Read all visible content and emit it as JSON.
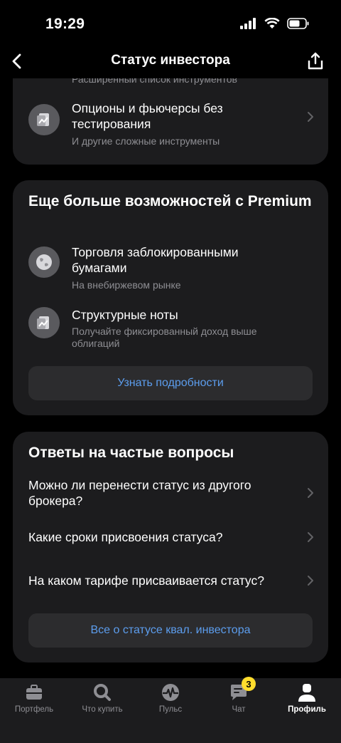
{
  "status_bar": {
    "time": "19:29"
  },
  "header": {
    "title": "Статус инвестора"
  },
  "card1": {
    "cut_subtitle": "Расширенный список инструментов",
    "item": {
      "title": "Опционы и фьючерсы без тестирования",
      "subtitle": "И другие сложные инструменты"
    }
  },
  "premium": {
    "title": "Еще больше возможностей с Premium",
    "items": [
      {
        "title": "Торговля заблокированными бумагами",
        "subtitle": "На внебиржевом рынке"
      },
      {
        "title": "Структурные ноты",
        "subtitle": "Получайте фиксированный доход выше облигаций"
      }
    ],
    "button": "Узнать подробности"
  },
  "faq": {
    "title": "Ответы на частые вопросы",
    "items": [
      "Можно ли перенести статус из другого брокера?",
      "Какие сроки присвоения статуса?",
      "На каком тарифе присваивается статус?"
    ],
    "button": "Все о статусе квал. инвестора"
  },
  "tabs": [
    {
      "label": "Портфель",
      "icon": "briefcase-icon"
    },
    {
      "label": "Что купить",
      "icon": "search-icon"
    },
    {
      "label": "Пульс",
      "icon": "pulse-icon"
    },
    {
      "label": "Чат",
      "icon": "chat-icon",
      "badge": "3"
    },
    {
      "label": "Профиль",
      "icon": "profile-icon",
      "active": true
    }
  ],
  "colors": {
    "background": "#000000",
    "card": "#1c1c1e",
    "accent_link": "#5c9ded",
    "badge": "#ffdd2d"
  }
}
